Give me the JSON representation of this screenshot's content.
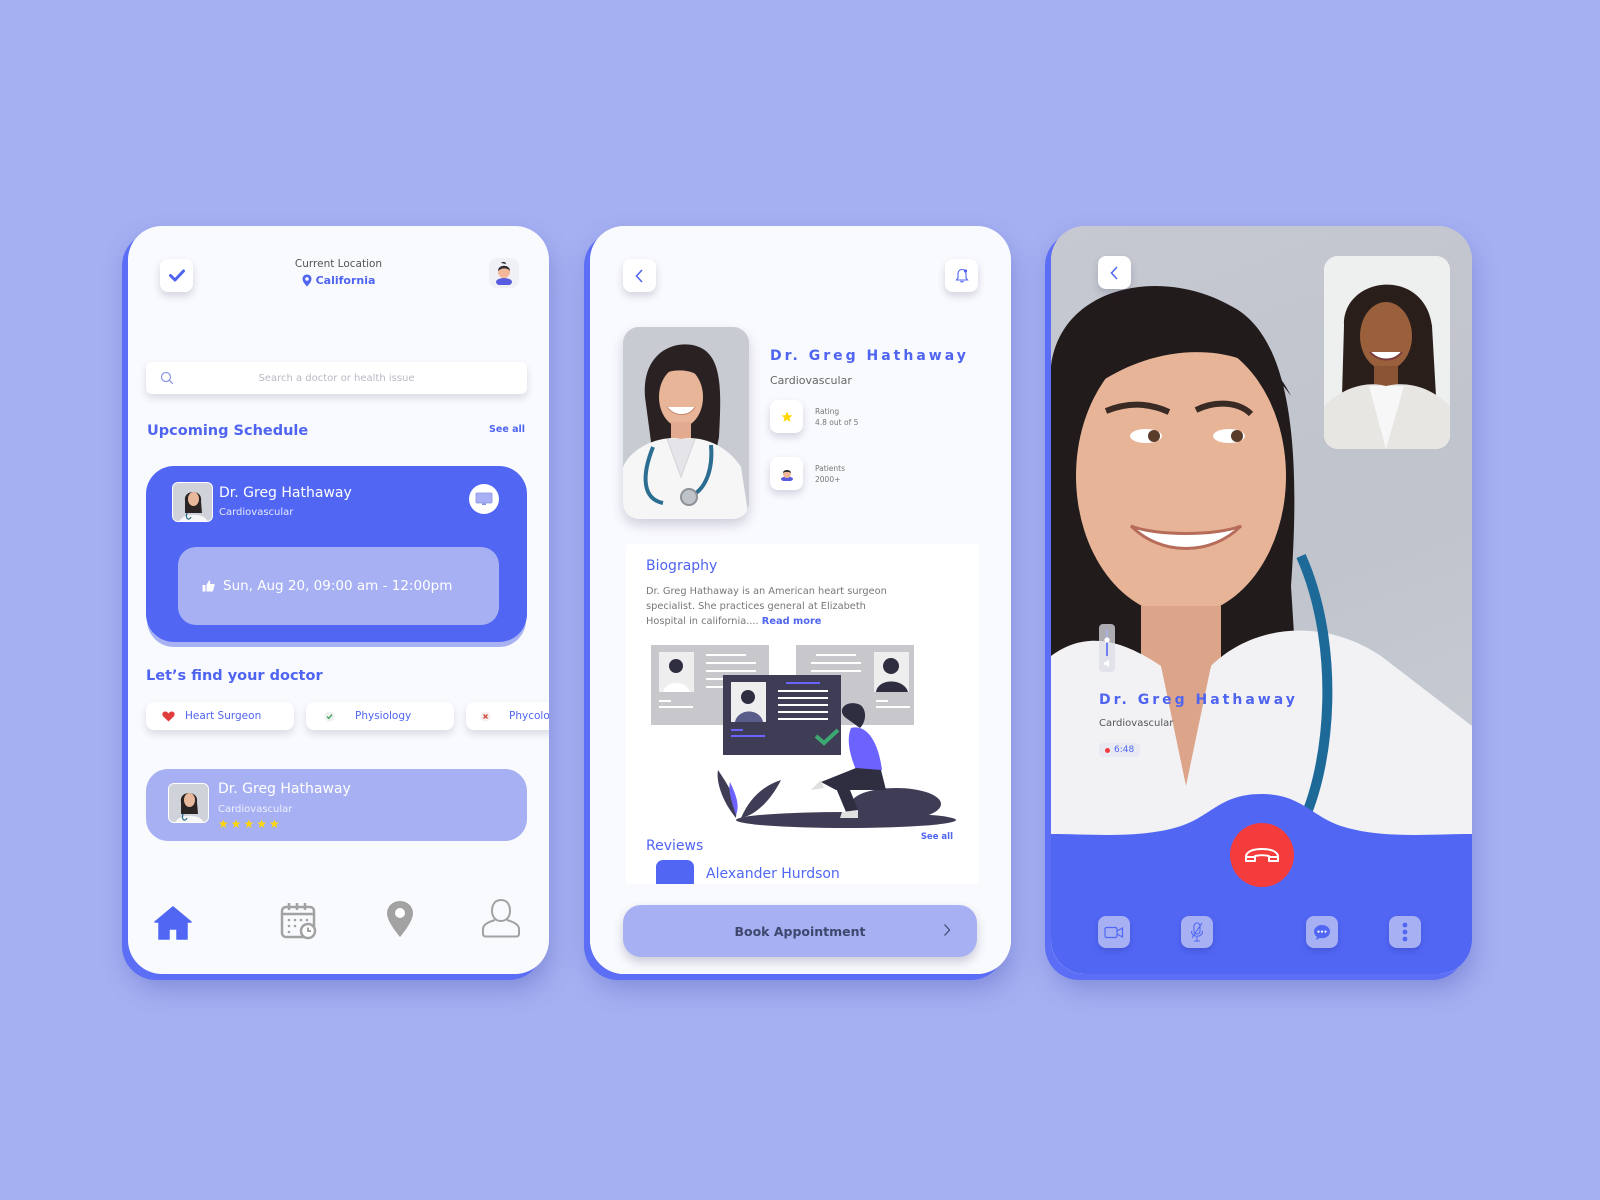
{
  "colors": {
    "background": "#a5b0f2",
    "accent": "#5167f4",
    "accent_light": "#a6b0f2",
    "end_call": "#f53c3c",
    "star": "#ffd600"
  },
  "home": {
    "check_icon": "check-icon",
    "location": {
      "label": "Current Location",
      "value": "California",
      "icon": "map-pin-icon"
    },
    "avatar_icon": "user-avatar-icon",
    "search": {
      "placeholder": "Search a doctor or health issue",
      "value": "",
      "icon": "search-icon"
    },
    "upcoming": {
      "title": "Upcoming Schedule",
      "see_all": "See all",
      "appointment": {
        "doctor": "Dr. Greg Hathaway",
        "specialty": "Cardiovascular",
        "time": "Sun, Aug 20, 09:00 am - 12:00pm",
        "screen_icon": "monitor-icon",
        "time_icon": "thumbs-up-icon"
      }
    },
    "find": {
      "title": "Let’s find your doctor",
      "categories": [
        {
          "label": "Heart Surgeon",
          "icon": "heart-icon"
        },
        {
          "label": "Physiology",
          "icon": "check-badge-icon"
        },
        {
          "label": "Phycology",
          "icon": "x-badge-icon"
        }
      ],
      "doctor_card": {
        "name": "Dr. Greg Hathaway",
        "specialty": "Cardiovascular",
        "rating_stars": 5,
        "stars_text": "★★★★★"
      }
    },
    "nav": [
      {
        "name": "home",
        "icon": "home-icon",
        "active": true
      },
      {
        "name": "schedule",
        "icon": "calendar-clock-icon",
        "active": false
      },
      {
        "name": "location",
        "icon": "map-pin-icon",
        "active": false
      },
      {
        "name": "profile",
        "icon": "user-icon",
        "active": false
      }
    ]
  },
  "profile": {
    "back_icon": "chevron-left-icon",
    "bell_icon": "bell-icon",
    "doctor": {
      "name": "Dr. Greg Hathaway",
      "specialty": "Cardiovascular"
    },
    "stats": [
      {
        "label": "Rating",
        "value": "4.8 out of 5",
        "icon": "star-icon"
      },
      {
        "label": "Patients",
        "value": "2000+",
        "icon": "patient-icon"
      }
    ],
    "biography": {
      "title": "Biography",
      "text": "Dr. Greg Hathaway is an American heart surgeon specialist. She practices general at Elizabeth Hospital in california....",
      "read_more": "Read more"
    },
    "reviews": {
      "title": "Reviews",
      "see_all": "See all",
      "first_reviewer": "Alexander Hurdson"
    },
    "book_button": "Book Appointment"
  },
  "call": {
    "back_icon": "chevron-left-icon",
    "doctor": {
      "name": "Dr. Greg Hathaway",
      "specialty": "Cardiovascular"
    },
    "duration": "6:48",
    "volume_level": 0.7,
    "controls": [
      {
        "name": "video",
        "icon": "video-camera-icon"
      },
      {
        "name": "mute",
        "icon": "mic-off-icon"
      },
      {
        "name": "chat",
        "icon": "chat-bubble-icon"
      },
      {
        "name": "more",
        "icon": "more-vertical-icon"
      }
    ],
    "end_call_icon": "phone-hangup-icon"
  }
}
